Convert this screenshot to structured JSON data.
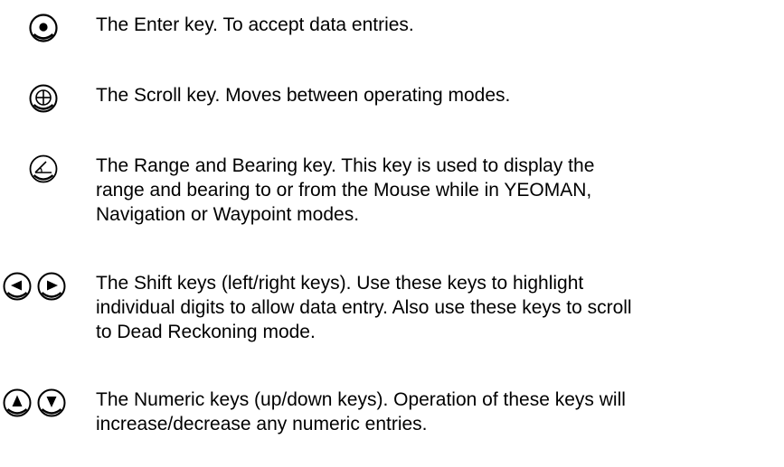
{
  "keys": [
    {
      "id": "enter",
      "icon": "enter-key-icon",
      "lines": [
        "The Enter key.  To accept data entries."
      ]
    },
    {
      "id": "scroll",
      "icon": "scroll-key-icon",
      "lines": [
        "The Scroll key.  Moves between operating modes."
      ]
    },
    {
      "id": "range",
      "icon": "range-bearing-key-icon",
      "lines": [
        "The Range and Bearing key.  This key is used to display the",
        "range and bearing to or from the Mouse while in YEOMAN,",
        "Navigation or Waypoint modes."
      ]
    },
    {
      "id": "shift",
      "icon": "shift-left-right-key-icons",
      "lines": [
        "The Shift keys (left/right keys).  Use these keys to highlight",
        "individual digits to allow data entry.  Also use these keys to scroll",
        "to Dead Reckoning mode."
      ]
    },
    {
      "id": "numeric",
      "icon": "numeric-up-down-key-icons",
      "lines": [
        "The Numeric keys (up/down keys).  Operation of these keys will",
        "increase/decrease any numeric entries."
      ]
    }
  ]
}
